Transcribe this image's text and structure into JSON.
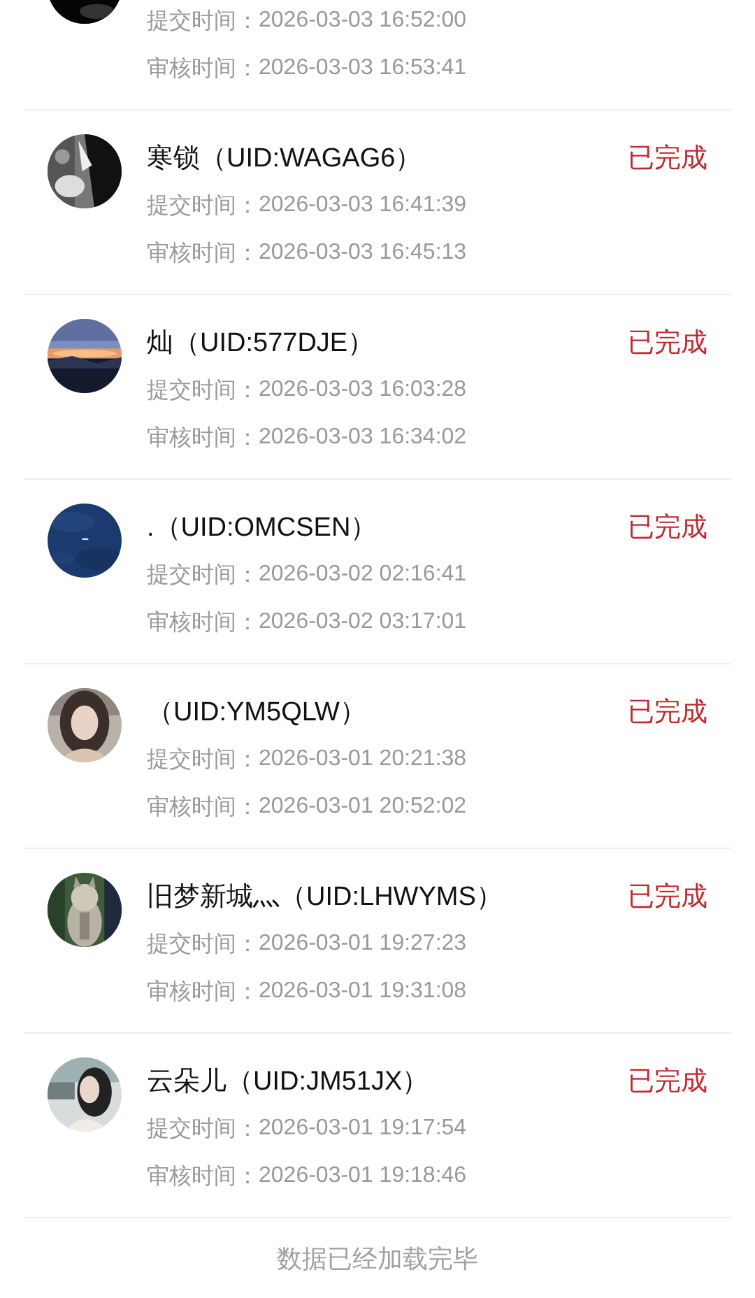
{
  "records": [
    {
      "submit_label": "提交时间：",
      "submit_time": "2026-03-03 16:52:00",
      "review_label": "审核时间：",
      "review_time": "2026-03-03 16:53:41"
    },
    {
      "name": "寒锁（UID:WAGAG6）",
      "status": "已完成",
      "submit_label": "提交时间：",
      "submit_time": "2026-03-03 16:41:39",
      "review_label": "审核时间：",
      "review_time": "2026-03-03 16:45:13"
    },
    {
      "name": "灿（UID:577DJE）",
      "status": "已完成",
      "submit_label": "提交时间：",
      "submit_time": "2026-03-03 16:03:28",
      "review_label": "审核时间：",
      "review_time": "2026-03-03 16:34:02"
    },
    {
      "name": ".（UID:OMCSEN）",
      "status": "已完成",
      "submit_label": "提交时间：",
      "submit_time": "2026-03-02 02:16:41",
      "review_label": "审核时间：",
      "review_time": "2026-03-02 03:17:01"
    },
    {
      "name": "（UID:YM5QLW）",
      "status": "已完成",
      "submit_label": "提交时间：",
      "submit_time": "2026-03-01 20:21:38",
      "review_label": "审核时间：",
      "review_time": "2026-03-01 20:52:02"
    },
    {
      "name": "旧梦新城灬（UID:LHWYMS）",
      "status": "已完成",
      "submit_label": "提交时间：",
      "submit_time": "2026-03-01 19:27:23",
      "review_label": "审核时间：",
      "review_time": "2026-03-01 19:31:08"
    },
    {
      "name": "云朵儿（UID:JM51JX）",
      "status": "已完成",
      "submit_label": "提交时间：",
      "submit_time": "2026-03-01 19:17:54",
      "review_label": "审核时间：",
      "review_time": "2026-03-01 19:18:46"
    }
  ],
  "footer": "数据已经加载完毕"
}
